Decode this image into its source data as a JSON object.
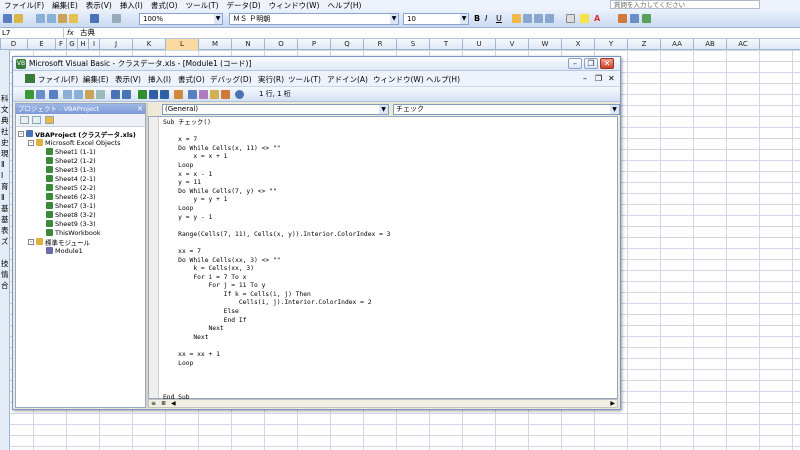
{
  "excel": {
    "menu": [
      "ファイル(F)",
      "編集(E)",
      "表示(V)",
      "挿入(I)",
      "書式(O)",
      "ツール(T)",
      "データ(D)",
      "ウィンドウ(W)",
      "ヘルプ(H)"
    ],
    "help_placeholder": "質問を入力してください",
    "zoom": "100%",
    "font_name": "ＭＳ Ｐ明朝",
    "font_size": "10",
    "namebox": "L7",
    "formula_value": "古典",
    "columns": [
      "D",
      "E",
      "F",
      "G",
      "H",
      "I",
      "J",
      "K",
      "L",
      "M",
      "N",
      "O",
      "P",
      "Q",
      "R",
      "S",
      "T",
      "U",
      "V",
      "W",
      "X",
      "Y",
      "Z",
      "AA",
      "AB",
      "AC"
    ],
    "selected_column": "L",
    "row_chars": [
      "科",
      "文",
      "典",
      "社",
      "史",
      "現",
      "Ⅱ",
      "Ⅰ",
      "育",
      "Ⅱ",
      "基",
      "基",
      "表",
      "ズ",
      "",
      "技",
      "情",
      "合"
    ]
  },
  "vbe": {
    "title": "Microsoft Visual Basic - クラスデータ.xls - [Module1 (コード)]",
    "menu": [
      "ファイル(F)",
      "編集(E)",
      "表示(V)",
      "挿入(I)",
      "書式(O)",
      "デバッグ(D)",
      "実行(R)",
      "ツール(T)",
      "アドイン(A)",
      "ウィンドウ(W)",
      "ヘルプ(H)"
    ],
    "cursor_position": "1 行, 1 桁",
    "project_title": "プロジェクト - VBAProject",
    "tree": [
      {
        "level": 0,
        "label": "VBAProject (クラスデータ.xls)",
        "bold": true,
        "toggle": "-",
        "icon": "project-icon"
      },
      {
        "level": 1,
        "label": "Microsoft Excel Objects",
        "bold": false,
        "toggle": "-",
        "icon": "folder-icon"
      },
      {
        "level": 2,
        "label": "Sheet1 (1-1)",
        "bold": false,
        "toggle": "",
        "icon": "sheet-icon"
      },
      {
        "level": 2,
        "label": "Sheet2 (1-2)",
        "bold": false,
        "toggle": "",
        "icon": "sheet-icon"
      },
      {
        "level": 2,
        "label": "Sheet3 (1-3)",
        "bold": false,
        "toggle": "",
        "icon": "sheet-icon"
      },
      {
        "level": 2,
        "label": "Sheet4 (2-1)",
        "bold": false,
        "toggle": "",
        "icon": "sheet-icon"
      },
      {
        "level": 2,
        "label": "Sheet5 (2-2)",
        "bold": false,
        "toggle": "",
        "icon": "sheet-icon"
      },
      {
        "level": 2,
        "label": "Sheet6 (2-3)",
        "bold": false,
        "toggle": "",
        "icon": "sheet-icon"
      },
      {
        "level": 2,
        "label": "Sheet7 (3-1)",
        "bold": false,
        "toggle": "",
        "icon": "sheet-icon"
      },
      {
        "level": 2,
        "label": "Sheet8 (3-2)",
        "bold": false,
        "toggle": "",
        "icon": "sheet-icon"
      },
      {
        "level": 2,
        "label": "Sheet9 (3-3)",
        "bold": false,
        "toggle": "",
        "icon": "sheet-icon"
      },
      {
        "level": 2,
        "label": "ThisWorkbook",
        "bold": false,
        "toggle": "",
        "icon": "workbook-icon"
      },
      {
        "level": 1,
        "label": "標準モジュール",
        "bold": false,
        "toggle": "-",
        "icon": "folder-icon"
      },
      {
        "level": 2,
        "label": "Module1",
        "bold": false,
        "toggle": "",
        "icon": "module-icon"
      }
    ],
    "object_combo": "(General)",
    "procedure_combo": "チェック",
    "code": "Sub チェック()\n\n    x = 7\n    Do While Cells(x, 11) <> \"\"\n        x = x + 1\n    Loop\n    x = x - 1\n    y = 11\n    Do While Cells(7, y) <> \"\"\n        y = y + 1\n    Loop\n    y = y - 1\n\n    Range(Cells(7, 11), Cells(x, y)).Interior.ColorIndex = 3\n\n    xx = 7\n    Do While Cells(xx, 3) <> \"\"\n        k = Cells(xx, 3)\n        For i = 7 To x\n            For j = 11 To y\n                If k = Cells(i, j) Then\n                    Cells(i, j).Interior.ColorIndex = 2\n                Else\n                End If\n            Next\n        Next\n\n    xx = xx + 1\n    Loop\n\n\n\nEnd Sub"
  }
}
